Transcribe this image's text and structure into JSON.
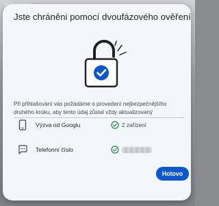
{
  "dialog": {
    "title": "Jste chráněni pomocí dvoufázového ověření",
    "description": "Při přihlašování vás požádáme o provedení nejbezpečnějšího druhého kroku, aby tento údaj zůstal vždy aktualizovaný",
    "methods": [
      {
        "label": "Výzva od Googlu",
        "value": "2 zařízení",
        "icon": "phone-icon",
        "status_icon": "check-circle-icon"
      },
      {
        "label": "Telefonní číslo",
        "value_masked": true,
        "icon": "sms-icon",
        "status_icon": "check-circle-icon"
      }
    ],
    "done_label": "Hotovo",
    "hero_icon": "lock-check-icon"
  },
  "colors": {
    "accent": "#0b57d0",
    "success": "#1e8e3e",
    "dialog_bg": "#f3f6fb",
    "text": "#1f1f1f"
  }
}
